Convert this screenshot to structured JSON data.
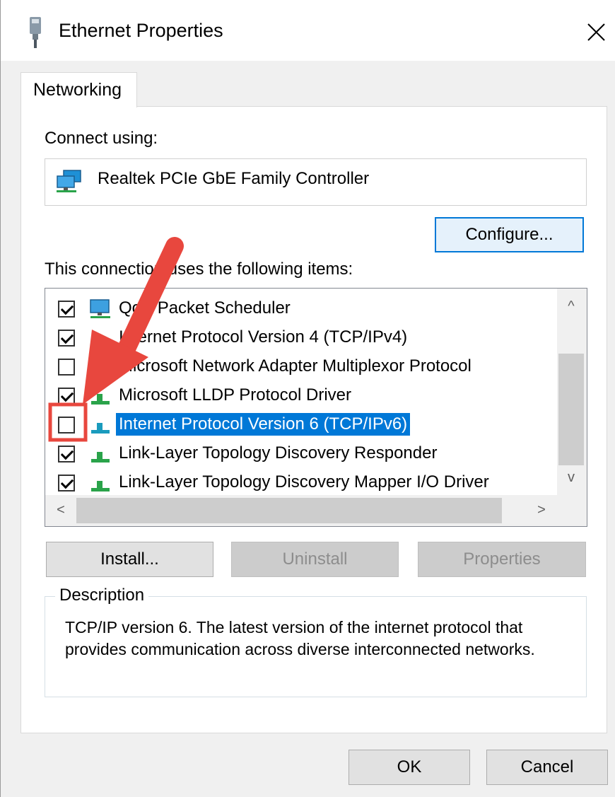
{
  "window": {
    "title": "Ethernet Properties",
    "close_glyph": "✕"
  },
  "tabs": [
    {
      "label": "Networking",
      "active": true
    }
  ],
  "connect_using": {
    "label": "Connect using:",
    "adapter_name": "Realtek PCIe GbE Family Controller",
    "adapter_icon": "network-adapter-icon"
  },
  "configure_button": "Configure...",
  "items_label": "This connection uses the following items:",
  "items": [
    {
      "label": "QoS Packet Scheduler",
      "checked": true,
      "selected": false,
      "icon": "scheduler-icon"
    },
    {
      "label": "Internet Protocol Version 4 (TCP/IPv4)",
      "checked": true,
      "selected": false,
      "icon": "protocol-icon"
    },
    {
      "label": "Microsoft Network Adapter Multiplexor Protocol",
      "checked": false,
      "selected": false,
      "icon": "protocol-icon"
    },
    {
      "label": "Microsoft LLDP Protocol Driver",
      "checked": true,
      "selected": false,
      "icon": "protocol-icon"
    },
    {
      "label": "Internet Protocol Version 6 (TCP/IPv6)",
      "checked": false,
      "selected": true,
      "icon": "protocol-icon"
    },
    {
      "label": "Link-Layer Topology Discovery Responder",
      "checked": true,
      "selected": false,
      "icon": "protocol-icon"
    },
    {
      "label": "Link-Layer Topology Discovery Mapper I/O Driver",
      "checked": true,
      "selected": false,
      "icon": "protocol-icon"
    }
  ],
  "scroll_glyphs": {
    "up": "^",
    "down": "v",
    "left": "<",
    "right": ">"
  },
  "buttons": {
    "install": "Install...",
    "uninstall": "Uninstall",
    "properties": "Properties",
    "ok": "OK",
    "cancel": "Cancel"
  },
  "description": {
    "legend": "Description",
    "text": "TCP/IP version 6. The latest version of the internet protocol that provides communication across diverse interconnected networks."
  },
  "colors": {
    "selection": "#0078d7",
    "annotation_red": "#e8473e",
    "disabled_text": "#8d8d8d"
  }
}
